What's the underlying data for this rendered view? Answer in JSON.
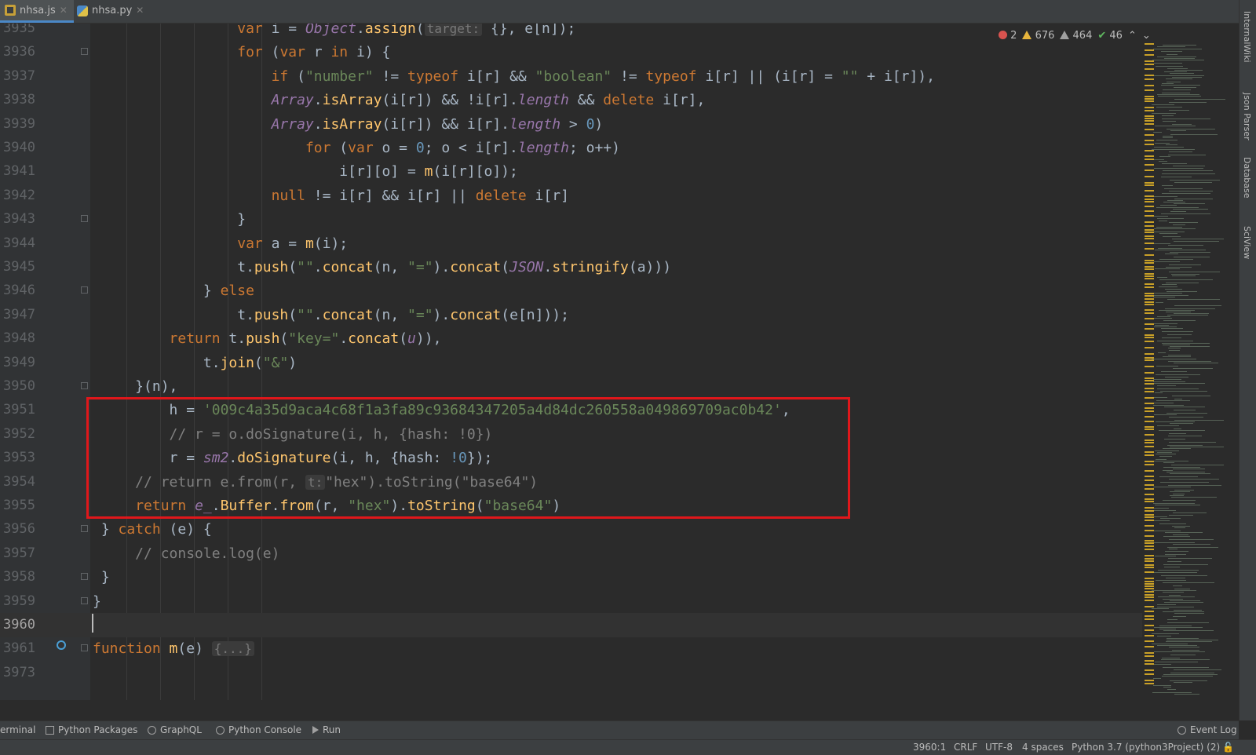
{
  "tabs": [
    {
      "label": "nhsa.js",
      "icon": "js-file-icon",
      "active": true
    },
    {
      "label": "nhsa.py",
      "icon": "python-file-icon",
      "active": false
    }
  ],
  "inspections": {
    "errors": "2",
    "warnings": "676",
    "weak_warnings": "464",
    "typos": "46"
  },
  "editor": {
    "lines": [
      {
        "num": "3935",
        "parts": [
          [
            "",
            "                 "
          ],
          [
            "kw",
            "var"
          ],
          [
            "",
            " i = "
          ],
          [
            "italic",
            "Object"
          ],
          [
            "",
            "."
          ],
          [
            "fn",
            "assign"
          ],
          [
            "",
            "("
          ],
          [
            "hint",
            "target:"
          ],
          [
            "",
            " {}, e[n]);"
          ]
        ]
      },
      {
        "num": "3936",
        "parts": [
          [
            "",
            "                 "
          ],
          [
            "kw",
            "for"
          ],
          [
            "",
            " ("
          ],
          [
            "kw",
            "var"
          ],
          [
            "",
            " r "
          ],
          [
            "kw",
            "in"
          ],
          [
            "",
            " i) {"
          ]
        ]
      },
      {
        "num": "3937",
        "parts": [
          [
            "",
            "                     "
          ],
          [
            "kw",
            "if"
          ],
          [
            "",
            " ("
          ],
          [
            "str",
            "\"number\""
          ],
          [
            "",
            " != "
          ],
          [
            "kw",
            "typeof"
          ],
          [
            "",
            " i[r] && "
          ],
          [
            "str",
            "\"boolean\""
          ],
          [
            "",
            " != "
          ],
          [
            "kw",
            "typeof"
          ],
          [
            "",
            " i[r] || (i[r] = "
          ],
          [
            "str",
            "\"\""
          ],
          [
            "",
            " + i[r]),"
          ]
        ]
      },
      {
        "num": "3938",
        "parts": [
          [
            "",
            "                     "
          ],
          [
            "italic",
            "Array"
          ],
          [
            "",
            "."
          ],
          [
            "fn",
            "isArray"
          ],
          [
            "",
            "(i[r]) && !i[r]."
          ],
          [
            "italic",
            "length"
          ],
          [
            "",
            " && "
          ],
          [
            "kw",
            "delete"
          ],
          [
            "",
            " i[r],"
          ]
        ]
      },
      {
        "num": "3939",
        "parts": [
          [
            "",
            "                     "
          ],
          [
            "italic",
            "Array"
          ],
          [
            "",
            "."
          ],
          [
            "fn",
            "isArray"
          ],
          [
            "",
            "(i[r]) && i[r]."
          ],
          [
            "italic",
            "length"
          ],
          [
            "",
            " > "
          ],
          [
            "num",
            "0"
          ],
          [
            "",
            ")"
          ]
        ]
      },
      {
        "num": "3940",
        "parts": [
          [
            "",
            "                         "
          ],
          [
            "kw",
            "for"
          ],
          [
            "",
            " ("
          ],
          [
            "kw",
            "var"
          ],
          [
            "",
            " o = "
          ],
          [
            "num",
            "0"
          ],
          [
            "",
            "; o < i[r]."
          ],
          [
            "italic",
            "length"
          ],
          [
            "",
            "; o++)"
          ]
        ]
      },
      {
        "num": "3941",
        "parts": [
          [
            "",
            "                             i[r][o] = "
          ],
          [
            "fn",
            "m"
          ],
          [
            "",
            "(i[r][o]);"
          ]
        ]
      },
      {
        "num": "3942",
        "parts": [
          [
            "",
            "                     "
          ],
          [
            "kw",
            "null"
          ],
          [
            "",
            " != i[r] && i[r] || "
          ],
          [
            "kw",
            "delete"
          ],
          [
            "",
            " i[r]"
          ]
        ]
      },
      {
        "num": "3943",
        "parts": [
          [
            "",
            "                 }"
          ]
        ]
      },
      {
        "num": "3944",
        "parts": [
          [
            "",
            "                 "
          ],
          [
            "kw",
            "var"
          ],
          [
            "",
            " a = "
          ],
          [
            "fn",
            "m"
          ],
          [
            "",
            "(i);"
          ]
        ]
      },
      {
        "num": "3945",
        "parts": [
          [
            "",
            "                 t."
          ],
          [
            "fn",
            "push"
          ],
          [
            "",
            "("
          ],
          [
            "str",
            "\"\""
          ],
          [
            "",
            "."
          ],
          [
            "fn",
            "concat"
          ],
          [
            "",
            "(n, "
          ],
          [
            "str",
            "\"=\""
          ],
          [
            "",
            ")."
          ],
          [
            "fn",
            "concat"
          ],
          [
            "",
            "("
          ],
          [
            "italic",
            "JSON"
          ],
          [
            "",
            "."
          ],
          [
            "fn",
            "stringify"
          ],
          [
            "",
            "(a)))"
          ]
        ]
      },
      {
        "num": "3946",
        "parts": [
          [
            "",
            "             } "
          ],
          [
            "kw",
            "else"
          ]
        ]
      },
      {
        "num": "3947",
        "parts": [
          [
            "",
            "                 t."
          ],
          [
            "fn",
            "push"
          ],
          [
            "",
            "("
          ],
          [
            "str",
            "\"\""
          ],
          [
            "",
            "."
          ],
          [
            "fn",
            "concat"
          ],
          [
            "",
            "(n, "
          ],
          [
            "str",
            "\"=\""
          ],
          [
            "",
            ")."
          ],
          [
            "fn",
            "concat"
          ],
          [
            "",
            "(e[n]));"
          ]
        ]
      },
      {
        "num": "3948",
        "parts": [
          [
            "",
            "         "
          ],
          [
            "kw",
            "return"
          ],
          [
            "",
            " t."
          ],
          [
            "fn",
            "push"
          ],
          [
            "",
            "("
          ],
          [
            "str",
            "\"key=\""
          ],
          [
            "",
            "."
          ],
          [
            "fn",
            "concat"
          ],
          [
            "",
            "("
          ],
          [
            "italic",
            "u"
          ],
          [
            "",
            ")),"
          ]
        ]
      },
      {
        "num": "3949",
        "parts": [
          [
            "",
            "             t."
          ],
          [
            "fn",
            "join"
          ],
          [
            "",
            "("
          ],
          [
            "str",
            "\"&\""
          ],
          [
            "",
            ")"
          ]
        ]
      },
      {
        "num": "3950",
        "parts": [
          [
            "",
            "     }(n),"
          ]
        ]
      },
      {
        "num": "3951",
        "parts": [
          [
            "",
            "         h = "
          ],
          [
            "str",
            "'009c4a35d9aca4c68f1a3fa89c93684347205a4d84dc260558a049869709ac0b42'"
          ],
          [
            "",
            ","
          ]
        ]
      },
      {
        "num": "3952",
        "parts": [
          [
            "cmt",
            "         // r = o.doSignature(i, h, {hash: !0})"
          ]
        ]
      },
      {
        "num": "3953",
        "parts": [
          [
            "",
            "         r = "
          ],
          [
            "italic",
            "sm2"
          ],
          [
            "",
            "."
          ],
          [
            "fn",
            "doSignature"
          ],
          [
            "",
            "(i, h, {hash: "
          ],
          [
            "num",
            "!0"
          ],
          [
            "",
            "});"
          ]
        ]
      },
      {
        "num": "3954",
        "parts": [
          [
            "cmt",
            "     // return e.from(r, "
          ],
          [
            "hint",
            "t:"
          ],
          [
            "cmt",
            "\"hex\").toString(\"base64\")"
          ]
        ]
      },
      {
        "num": "3955",
        "parts": [
          [
            "",
            "     "
          ],
          [
            "kw",
            "return"
          ],
          [
            "",
            " "
          ],
          [
            "italic",
            "e_"
          ],
          [
            "",
            "."
          ],
          [
            "fn",
            "Buffer"
          ],
          [
            "",
            "."
          ],
          [
            "fn",
            "from"
          ],
          [
            "",
            "(r, "
          ],
          [
            "str",
            "\"hex\""
          ],
          [
            "",
            ")."
          ],
          [
            "fn",
            "toString"
          ],
          [
            "",
            "("
          ],
          [
            "str",
            "\"base64\""
          ],
          [
            "",
            ")"
          ]
        ]
      },
      {
        "num": "3956",
        "parts": [
          [
            "",
            " } "
          ],
          [
            "kw",
            "catch"
          ],
          [
            "",
            " (e) {"
          ]
        ]
      },
      {
        "num": "3957",
        "parts": [
          [
            "cmt",
            "     // console.log(e)"
          ]
        ]
      },
      {
        "num": "3958",
        "parts": [
          [
            "",
            " }"
          ]
        ]
      },
      {
        "num": "3959",
        "parts": [
          [
            "",
            "}"
          ]
        ]
      },
      {
        "num": "3960",
        "parts": [
          [
            "",
            ""
          ]
        ]
      },
      {
        "num": "3961",
        "parts": [
          [
            "kw",
            "function"
          ],
          [
            "",
            " "
          ],
          [
            "fn",
            "m"
          ],
          [
            "",
            "(e) "
          ],
          [
            "hint",
            "{...}"
          ]
        ]
      },
      {
        "num": "3973",
        "parts": [
          [
            "",
            ""
          ]
        ]
      }
    ]
  },
  "right_tools": [
    "InternalWiki",
    "Json Parser",
    "Database",
    "SciView"
  ],
  "tool_windows": [
    "erminal",
    "Python Packages",
    "GraphQL",
    "Python Console",
    "Run",
    "Event Log"
  ],
  "status": {
    "position": "3960:1",
    "line_sep": "CRLF",
    "encoding": "UTF-8",
    "indent": "4 spaces",
    "interpreter": "Python 3.7 (python3Project) (2)"
  },
  "colors": {
    "accent": "#4a88c7",
    "highlight_box": "#e0171b",
    "warning": "#e8b53c"
  }
}
